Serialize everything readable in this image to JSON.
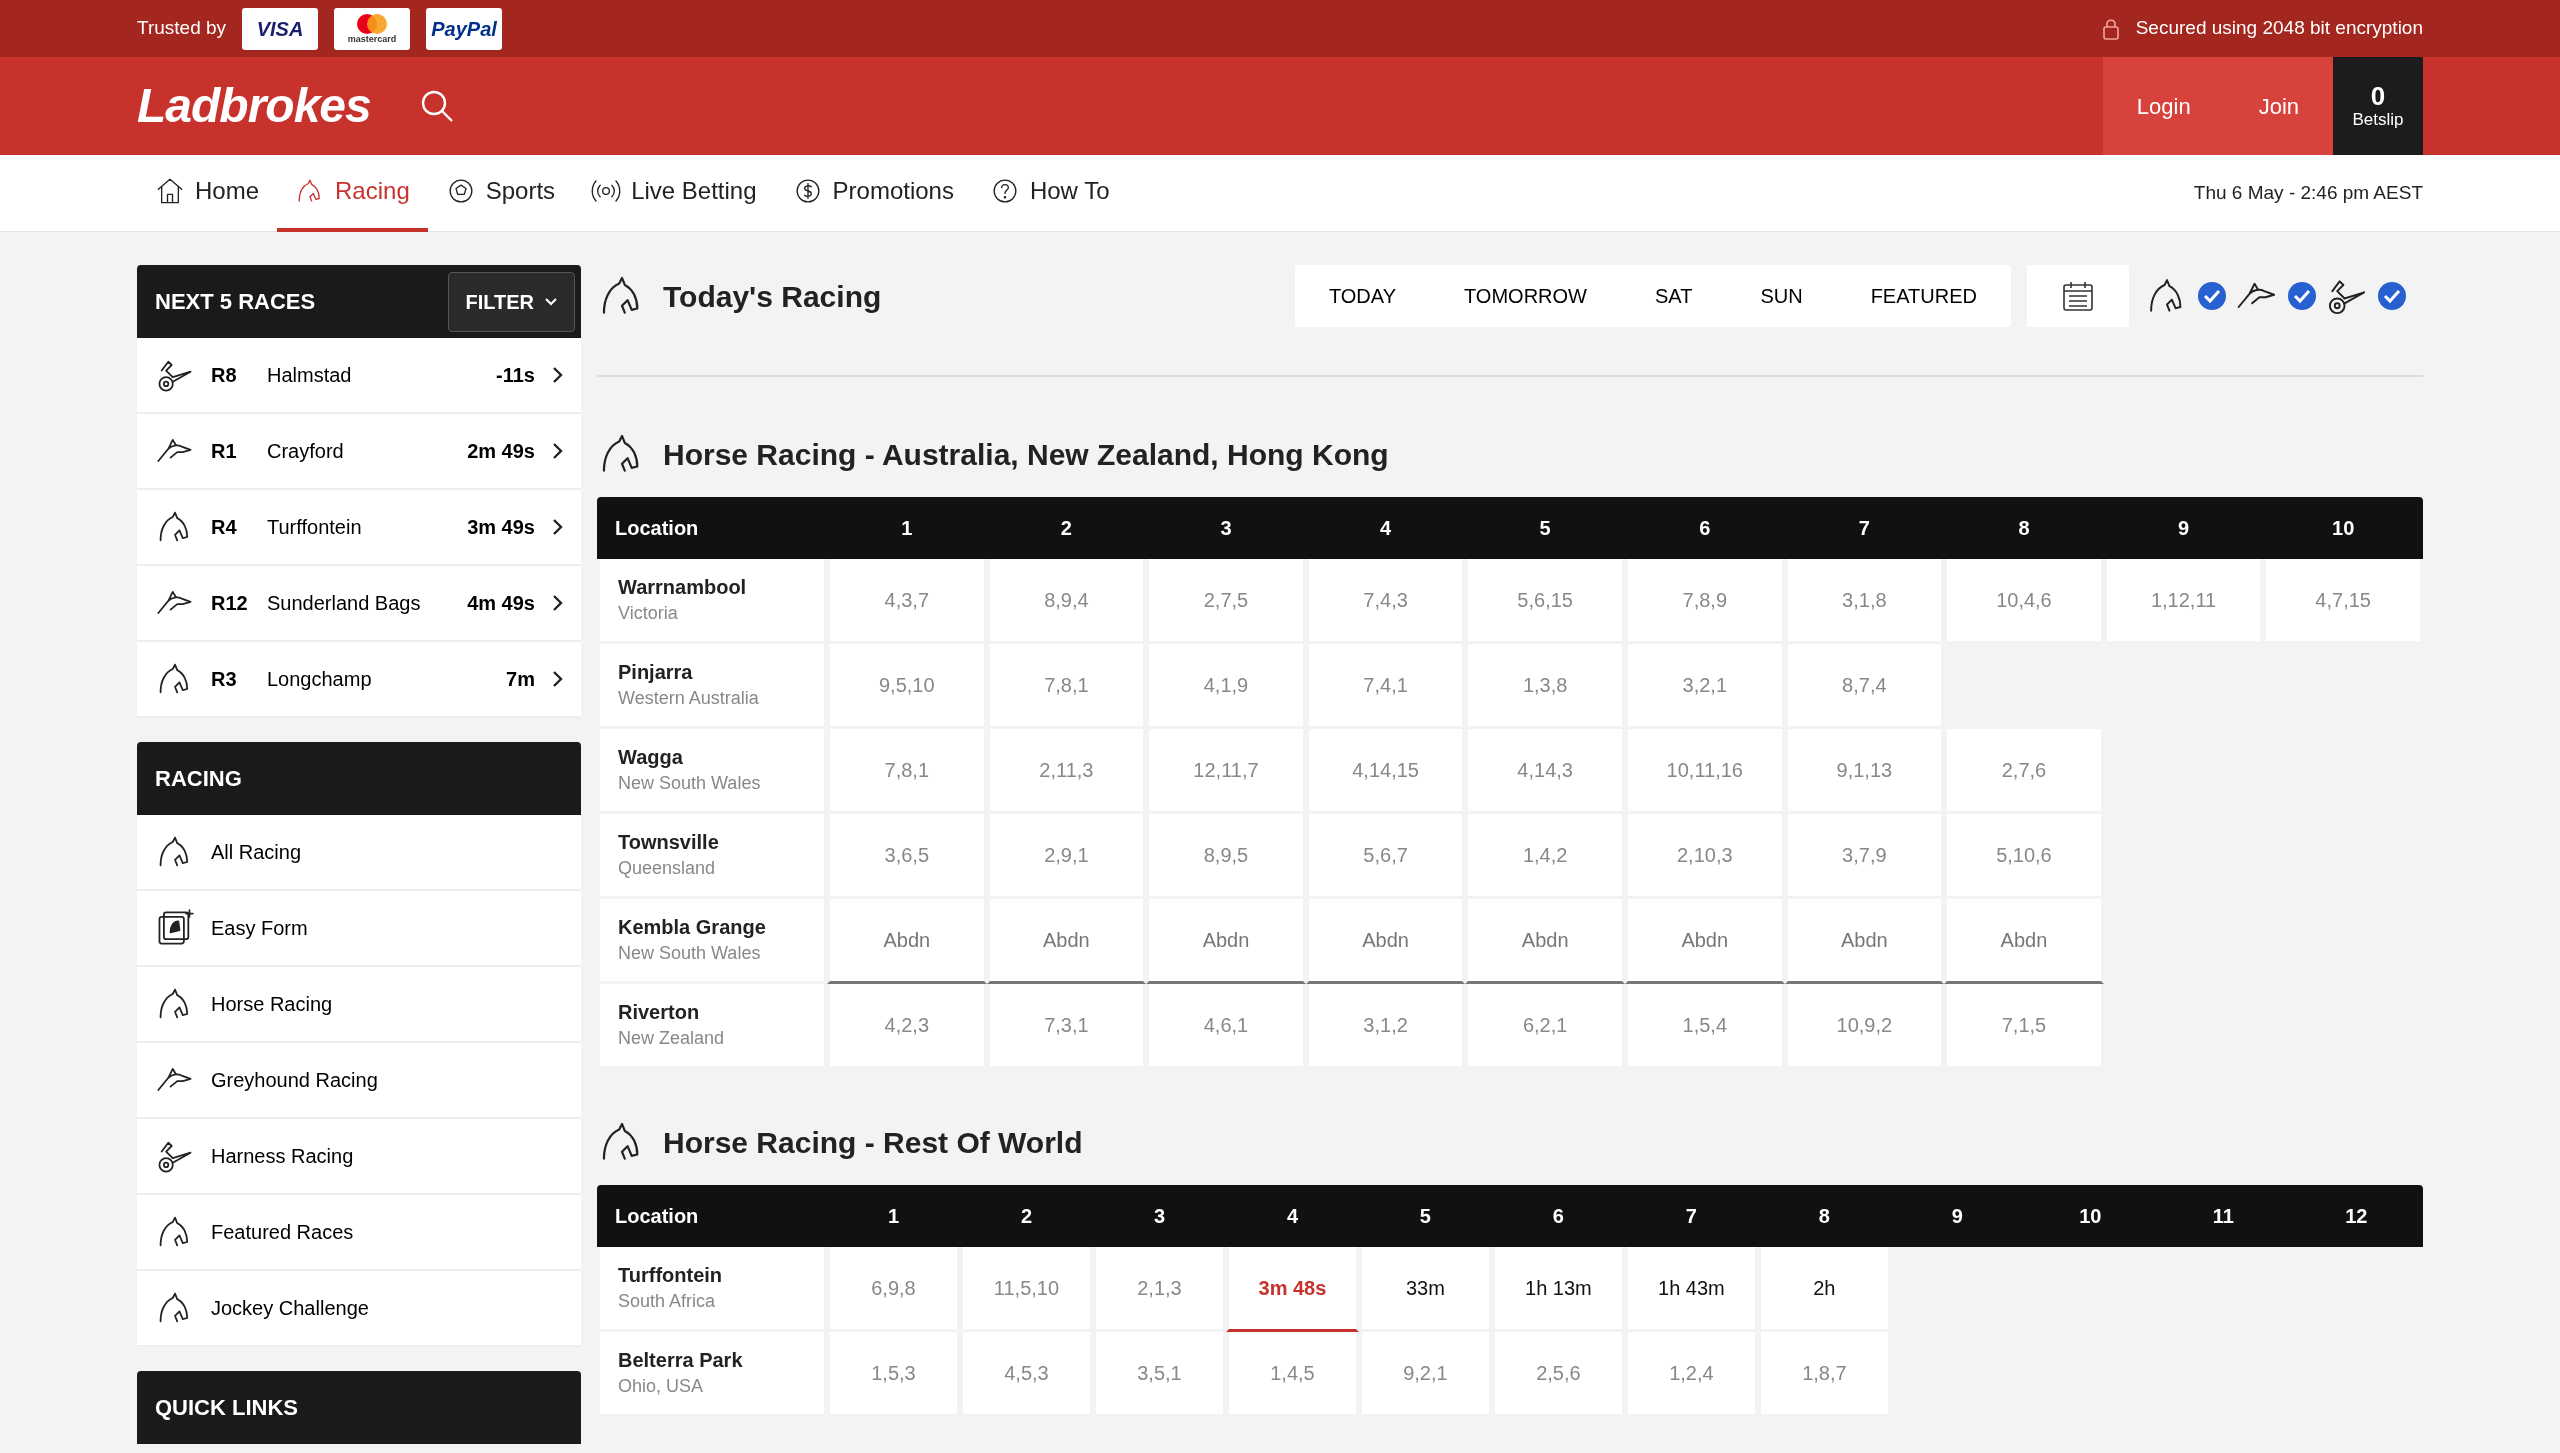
{
  "top_bar": {
    "trusted_label": "Trusted by",
    "payment_badges": [
      "VISA",
      "mastercard",
      "PayPal"
    ],
    "security_text": "Secured using 2048 bit encryption"
  },
  "header": {
    "logo": "Ladbrokes",
    "login": "Login",
    "join": "Join",
    "betslip": {
      "count": "0",
      "label": "Betslip"
    }
  },
  "nav": {
    "items": [
      {
        "label": "Home",
        "kind": "home",
        "selected": false
      },
      {
        "label": "Racing",
        "kind": "horse",
        "selected": true
      },
      {
        "label": "Sports",
        "kind": "ball",
        "selected": false
      },
      {
        "label": "Live Betting",
        "kind": "live",
        "selected": false
      },
      {
        "label": "Promotions",
        "kind": "dollar",
        "selected": false
      },
      {
        "label": "How To",
        "kind": "help",
        "selected": false
      }
    ],
    "datetime": "Thu 6 May - 2:46 pm AEST"
  },
  "next_races": {
    "title": "NEXT 5 RACES",
    "filter": "FILTER",
    "races": [
      {
        "kind": "harness",
        "race": "R8",
        "venue": "Halmstad",
        "time": "-11s"
      },
      {
        "kind": "greyhound",
        "race": "R1",
        "venue": "Crayford",
        "time": "2m 49s"
      },
      {
        "kind": "horse",
        "race": "R4",
        "venue": "Turffontein",
        "time": "3m 49s"
      },
      {
        "kind": "greyhound",
        "race": "R12",
        "venue": "Sunderland Bags",
        "time": "4m 49s"
      },
      {
        "kind": "horse",
        "race": "R3",
        "venue": "Longchamp",
        "time": "7m"
      }
    ]
  },
  "racing_menu": {
    "title": "RACING",
    "items": [
      {
        "kind": "horse",
        "label": "All Racing"
      },
      {
        "kind": "form",
        "label": "Easy Form"
      },
      {
        "kind": "horse",
        "label": "Horse Racing"
      },
      {
        "kind": "greyhound",
        "label": "Greyhound Racing"
      },
      {
        "kind": "harness",
        "label": "Harness Racing"
      },
      {
        "kind": "horse",
        "label": "Featured Races"
      },
      {
        "kind": "horse",
        "label": "Jockey Challenge"
      }
    ]
  },
  "quick_links": {
    "title": "QUICK LINKS"
  },
  "todays_racing": {
    "title": "Today's Racing",
    "day_tabs": [
      "TODAY",
      "TOMORROW",
      "SAT",
      "SUN",
      "FEATURED"
    ],
    "type_filters": [
      {
        "kind": "horse",
        "checked": true
      },
      {
        "kind": "greyhound",
        "checked": true
      },
      {
        "kind": "harness",
        "checked": true
      }
    ]
  },
  "sections": [
    {
      "title": "Horse Racing - Australia, New Zealand, Hong Kong",
      "columns": [
        "Location",
        "1",
        "2",
        "3",
        "4",
        "5",
        "6",
        "7",
        "8",
        "9",
        "10"
      ],
      "rows": [
        {
          "cells": [
            {
              "kind": "location",
              "text": "Warrnambool",
              "subtext": "Victoria"
            },
            {
              "kind": "result",
              "text": "4,3,7"
            },
            {
              "kind": "result",
              "text": "8,9,4"
            },
            {
              "kind": "result",
              "text": "2,7,5"
            },
            {
              "kind": "result",
              "text": "7,4,3"
            },
            {
              "kind": "result",
              "text": "5,6,15"
            },
            {
              "kind": "result",
              "text": "7,8,9"
            },
            {
              "kind": "result",
              "text": "3,1,8"
            },
            {
              "kind": "result",
              "text": "10,4,6"
            },
            {
              "kind": "result",
              "text": "1,12,11"
            },
            {
              "kind": "result",
              "text": "4,7,15"
            }
          ]
        },
        {
          "cells": [
            {
              "kind": "location",
              "text": "Pinjarra",
              "subtext": "Western Australia"
            },
            {
              "kind": "result",
              "text": "9,5,10"
            },
            {
              "kind": "result",
              "text": "7,8,1"
            },
            {
              "kind": "result",
              "text": "4,1,9"
            },
            {
              "kind": "result",
              "text": "7,4,1"
            },
            {
              "kind": "result",
              "text": "1,3,8"
            },
            {
              "kind": "result",
              "text": "3,2,1"
            },
            {
              "kind": "result",
              "text": "8,7,4"
            }
          ]
        },
        {
          "cells": [
            {
              "kind": "location",
              "text": "Wagga",
              "subtext": "New South Wales"
            },
            {
              "kind": "result",
              "text": "7,8,1"
            },
            {
              "kind": "result",
              "text": "2,11,3"
            },
            {
              "kind": "result",
              "text": "12,11,7"
            },
            {
              "kind": "result",
              "text": "4,14,15"
            },
            {
              "kind": "result",
              "text": "4,14,3"
            },
            {
              "kind": "result",
              "text": "10,11,16"
            },
            {
              "kind": "result",
              "text": "9,1,13"
            },
            {
              "kind": "result",
              "text": "2,7,6"
            }
          ]
        },
        {
          "cells": [
            {
              "kind": "location",
              "text": "Townsville",
              "subtext": "Queensland"
            },
            {
              "kind": "result",
              "text": "3,6,5"
            },
            {
              "kind": "result",
              "text": "2,9,1"
            },
            {
              "kind": "result",
              "text": "8,9,5"
            },
            {
              "kind": "result",
              "text": "5,6,7"
            },
            {
              "kind": "result",
              "text": "1,4,2"
            },
            {
              "kind": "result",
              "text": "2,10,3"
            },
            {
              "kind": "result",
              "text": "3,7,9"
            },
            {
              "kind": "result",
              "text": "5,10,6"
            }
          ]
        },
        {
          "cells": [
            {
              "kind": "location",
              "text": "Kembla Grange",
              "subtext": "New South Wales"
            },
            {
              "kind": "abandoned",
              "text": "Abdn"
            },
            {
              "kind": "abandoned",
              "text": "Abdn"
            },
            {
              "kind": "abandoned",
              "text": "Abdn"
            },
            {
              "kind": "abandoned",
              "text": "Abdn"
            },
            {
              "kind": "abandoned",
              "text": "Abdn"
            },
            {
              "kind": "abandoned",
              "text": "Abdn"
            },
            {
              "kind": "abandoned",
              "text": "Abdn"
            },
            {
              "kind": "abandoned",
              "text": "Abdn"
            }
          ]
        },
        {
          "cells": [
            {
              "kind": "location",
              "text": "Riverton",
              "subtext": "New Zealand"
            },
            {
              "kind": "result",
              "text": "4,2,3"
            },
            {
              "kind": "result",
              "text": "7,3,1"
            },
            {
              "kind": "result",
              "text": "4,6,1"
            },
            {
              "kind": "result",
              "text": "3,1,2"
            },
            {
              "kind": "result",
              "text": "6,2,1"
            },
            {
              "kind": "result",
              "text": "1,5,4"
            },
            {
              "kind": "result",
              "text": "10,9,2"
            },
            {
              "kind": "result",
              "text": "7,1,5"
            }
          ]
        }
      ]
    },
    {
      "title": "Horse Racing - Rest Of World",
      "columns": [
        "Location",
        "1",
        "2",
        "3",
        "4",
        "5",
        "6",
        "7",
        "8",
        "9",
        "10",
        "11",
        "12"
      ],
      "rows": [
        {
          "cells": [
            {
              "kind": "location",
              "text": "Turffontein",
              "subtext": "South Africa"
            },
            {
              "kind": "result",
              "text": "6,9,8"
            },
            {
              "kind": "result",
              "text": "11,5,10"
            },
            {
              "kind": "result",
              "text": "2,1,3"
            },
            {
              "kind": "next",
              "text": "3m 48s"
            },
            {
              "kind": "time",
              "text": "33m"
            },
            {
              "kind": "time",
              "text": "1h 13m"
            },
            {
              "kind": "time",
              "text": "1h 43m"
            },
            {
              "kind": "time",
              "text": "2h"
            }
          ]
        },
        {
          "cells": [
            {
              "kind": "location",
              "text": "Belterra Park",
              "subtext": "Ohio, USA"
            },
            {
              "kind": "result",
              "text": "1,5,3"
            },
            {
              "kind": "result",
              "text": "4,5,3"
            },
            {
              "kind": "result",
              "text": "3,5,1"
            },
            {
              "kind": "result",
              "text": "1,4,5"
            },
            {
              "kind": "result",
              "text": "9,2,1"
            },
            {
              "kind": "result",
              "text": "2,5,6"
            },
            {
              "kind": "result",
              "text": "1,2,4"
            },
            {
              "kind": "result",
              "text": "1,8,7"
            }
          ]
        }
      ]
    }
  ]
}
